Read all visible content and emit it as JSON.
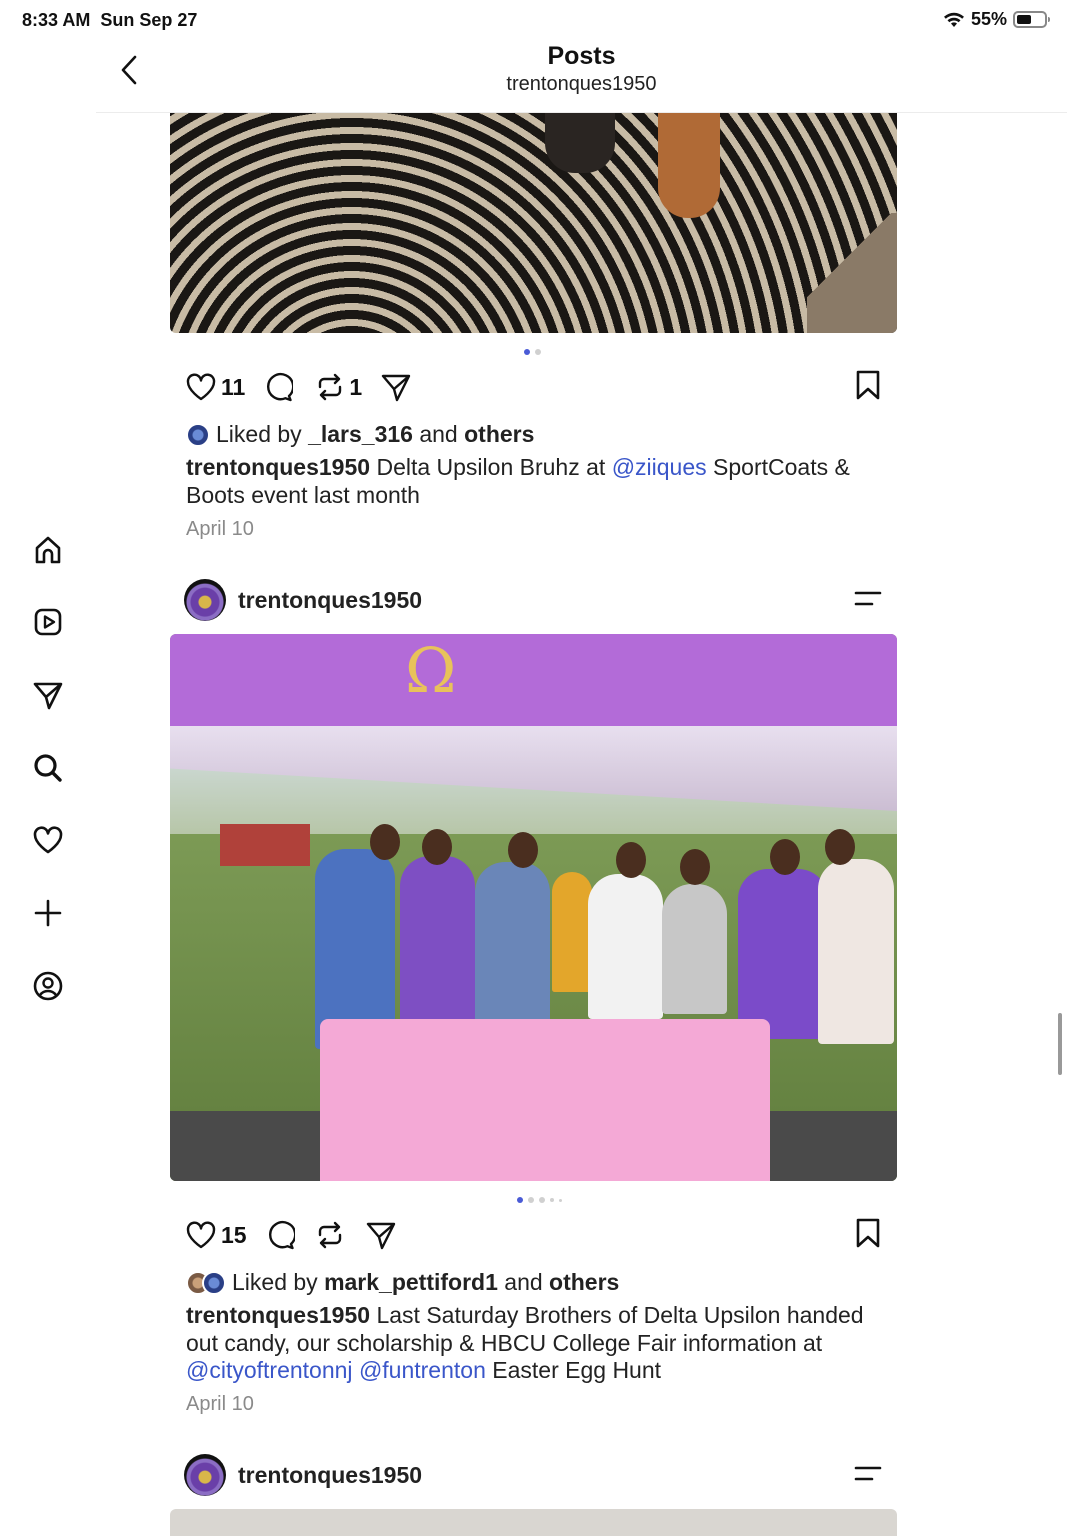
{
  "status": {
    "time": "8:33 AM",
    "date": "Sun Sep 27",
    "battery": "55%",
    "battery_level": 0.55
  },
  "header": {
    "title": "Posts",
    "subtitle": "trentonques1950"
  },
  "nav": [
    "home-icon",
    "reels-icon",
    "messages-icon",
    "search-icon",
    "activity-icon",
    "create-icon",
    "profile-icon"
  ],
  "posts": [
    {
      "likes_count": "11",
      "reposts_count": "1",
      "liked_by_prefix": "Liked by",
      "liked_by_user": "_lars_316",
      "liked_by_and": "and",
      "liked_by_others": "others",
      "author": "trentonques1950",
      "caption_1": " Delta Upsilon Bruhz at ",
      "mention_1": "@ziiques",
      "caption_2": " SportCoats & Boots event last month",
      "date": "April 10",
      "carousel_index": 1,
      "carousel_total": 2
    },
    {
      "username": "trentonques1950",
      "likes_count": "15",
      "liked_by_prefix": "Liked by",
      "liked_by_user": "mark_pettiford1",
      "liked_by_and": "and",
      "liked_by_others": "others",
      "author": "trentonques1950",
      "caption_1": " Last Saturday Brothers of Delta Upsilon handed out candy, our scholarship & HBCU College Fair information at ",
      "mention_1": "@cityoftrentonnj",
      "mention_2": "@funtrenton",
      "caption_2": " Easter Egg Hunt",
      "date": "April 10",
      "carousel_index": 1,
      "carousel_total": 5
    },
    {
      "username": "trentonques1950"
    }
  ],
  "colors": {
    "accent": "#3a56c9",
    "dot_active": "#4a5bd6",
    "canopy": "#b36bd8",
    "table": "#f4a9d6"
  }
}
